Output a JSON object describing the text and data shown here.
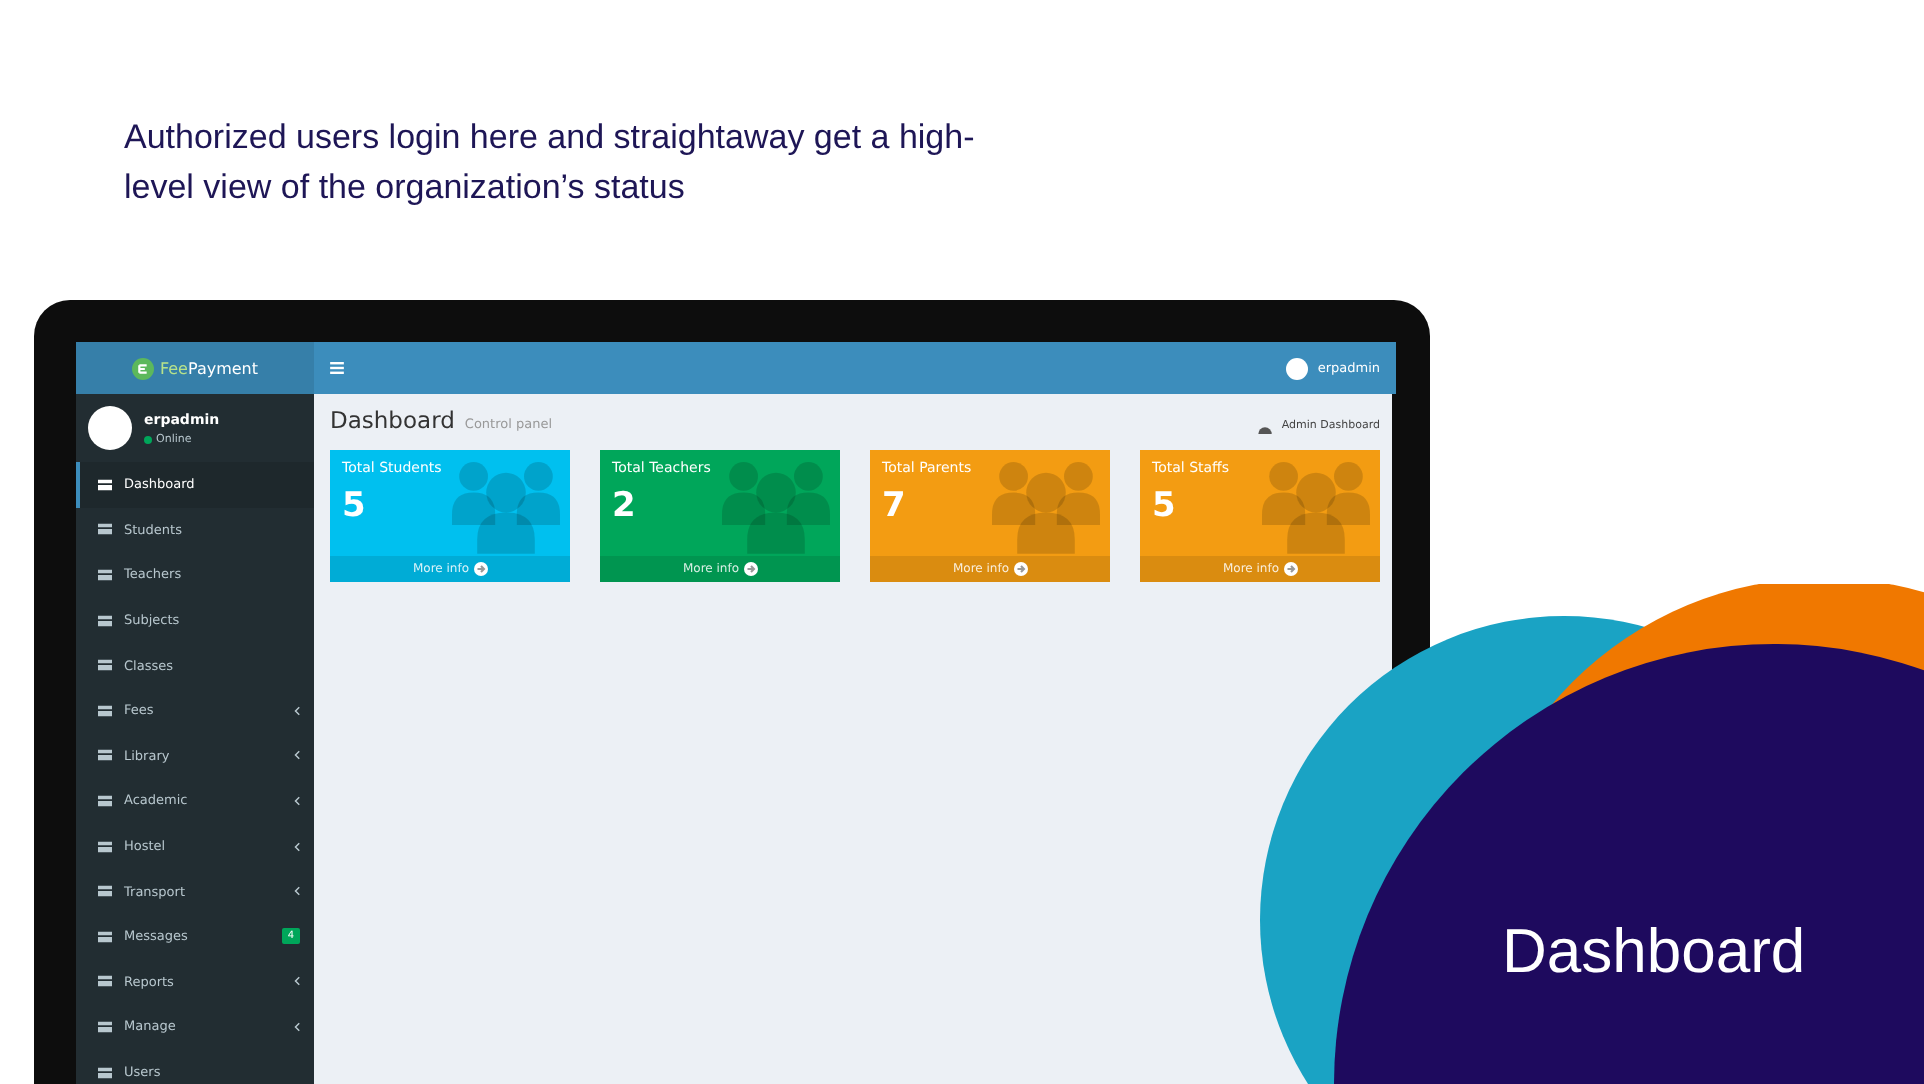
{
  "intro": "Authorized users login here and straightaway get a high-level view of the organization’s status",
  "app": {
    "logo": {
      "brand_first": "Fee",
      "brand_second": "Payment"
    },
    "user": {
      "name": "erpadmin",
      "status": "Online"
    },
    "topbar_user": "erpadmin",
    "sidebar": [
      {
        "label": "Dashboard",
        "selected": true,
        "expandable": false
      },
      {
        "label": "Students",
        "selected": false,
        "expandable": false
      },
      {
        "label": "Teachers",
        "selected": false,
        "expandable": false
      },
      {
        "label": "Subjects",
        "selected": false,
        "expandable": false
      },
      {
        "label": "Classes",
        "selected": false,
        "expandable": false
      },
      {
        "label": "Fees",
        "selected": false,
        "expandable": true
      },
      {
        "label": "Library",
        "selected": false,
        "expandable": true
      },
      {
        "label": "Academic",
        "selected": false,
        "expandable": true
      },
      {
        "label": "Hostel",
        "selected": false,
        "expandable": true
      },
      {
        "label": "Transport",
        "selected": false,
        "expandable": true
      },
      {
        "label": "Messages",
        "selected": false,
        "expandable": false,
        "badge": "4"
      },
      {
        "label": "Reports",
        "selected": false,
        "expandable": true
      },
      {
        "label": "Manage",
        "selected": false,
        "expandable": true
      },
      {
        "label": "Users",
        "selected": false,
        "expandable": false
      }
    ],
    "page_title": "Dashboard",
    "page_subtitle": "Control panel",
    "breadcrumb": "Admin Dashboard",
    "cards": [
      {
        "title": "Total Students",
        "value": "5",
        "link": "More info",
        "color": "#00c0ef"
      },
      {
        "title": "Total Teachers",
        "value": "2",
        "link": "More info",
        "color": "#00a65a"
      },
      {
        "title": "Total Parents",
        "value": "7",
        "link": "More info",
        "color": "#f39c12"
      },
      {
        "title": "Total Staffs",
        "value": "5",
        "link": "More info",
        "color": "#f39c12"
      }
    ]
  },
  "slide_label": "Dashboard"
}
